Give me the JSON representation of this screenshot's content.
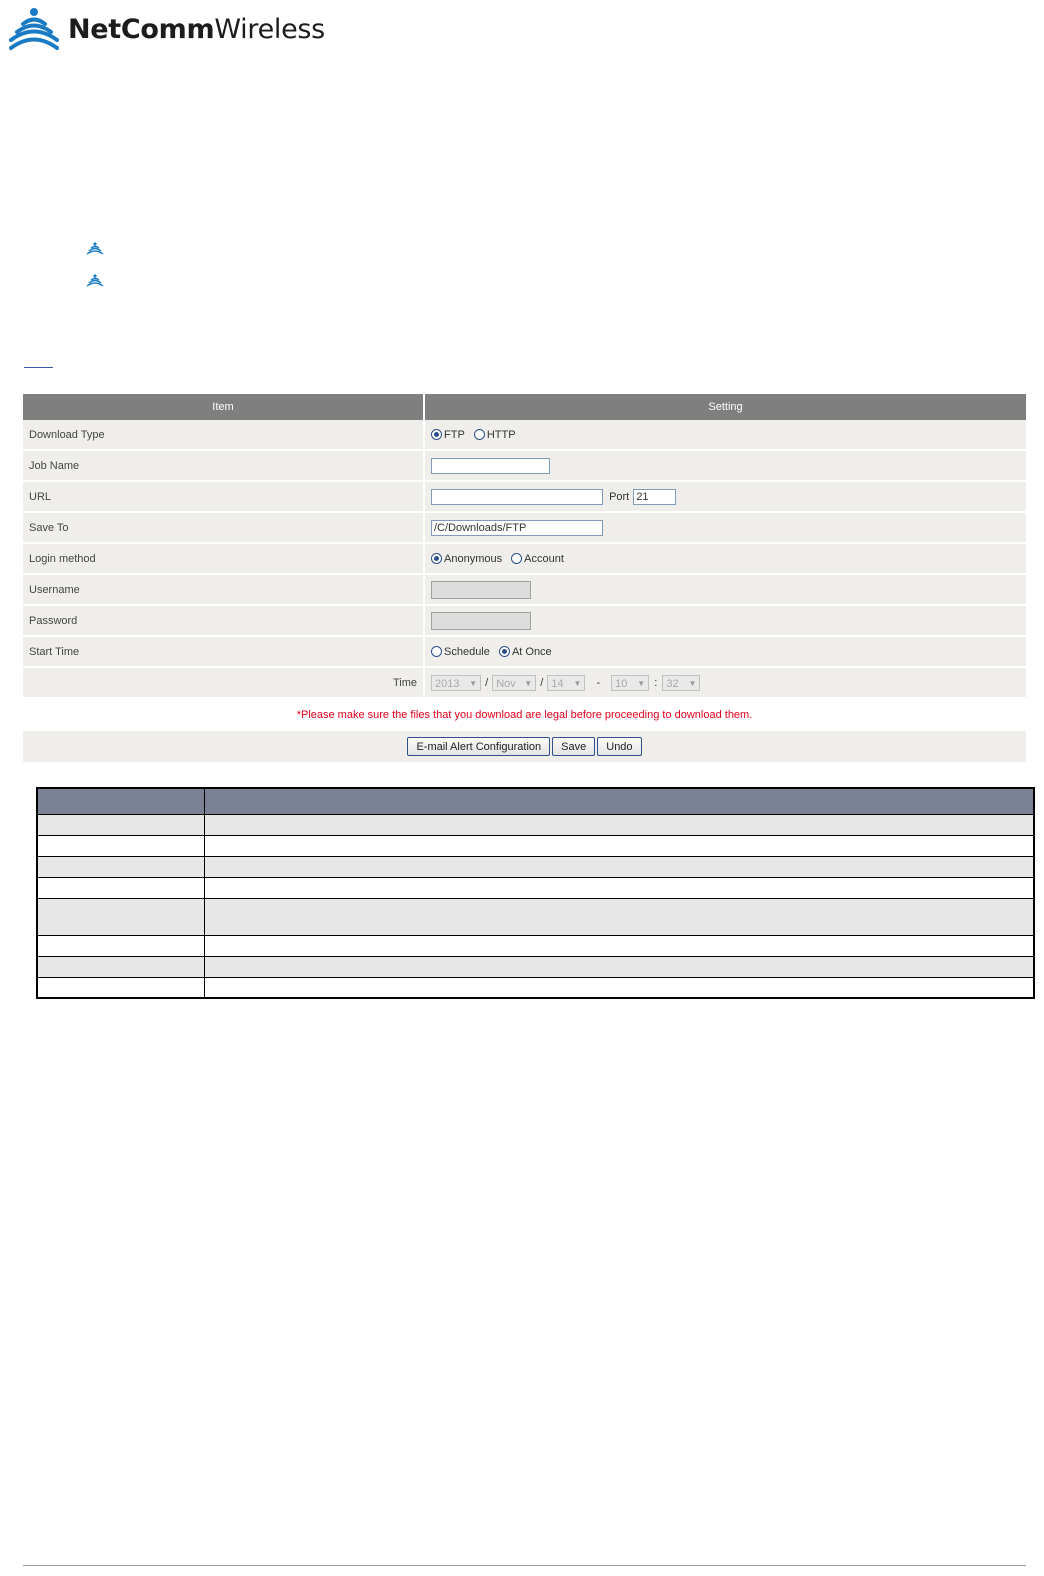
{
  "brand": {
    "bold": "NetComm",
    "light": "Wireless"
  },
  "bullet_icon": "netcomm-wifi-bullet-icon",
  "config_table": {
    "headers": {
      "item": "Item",
      "setting": "Setting"
    },
    "download_type": {
      "label": "Download Type",
      "opt1": "FTP",
      "opt2": "HTTP",
      "selected": "FTP"
    },
    "job_name": {
      "label": "Job Name",
      "value": ""
    },
    "url": {
      "label": "URL",
      "value": "",
      "port_label": "Port",
      "port_value": "21"
    },
    "save_to": {
      "label": "Save To",
      "value": "/C/Downloads/FTP"
    },
    "login_method": {
      "label": "Login method",
      "opt1": "Anonymous",
      "opt2": "Account",
      "selected": "Anonymous"
    },
    "username": {
      "label": "Username",
      "value": ""
    },
    "password": {
      "label": "Password",
      "value": ""
    },
    "start_time": {
      "label": "Start Time",
      "opt1": "Schedule",
      "opt2": "At Once",
      "selected": "At Once"
    },
    "time": {
      "label": "Time",
      "year": "2013",
      "month": "Nov",
      "day": "14",
      "hour": "10",
      "minute": "32",
      "sep_slash": "/",
      "sep_dash": "-",
      "sep_colon": ":"
    },
    "notice": "*Please make sure the files that you download are legal before proceeding to download them.",
    "buttons": {
      "email": "E-mail Alert Configuration",
      "save": "Save",
      "undo": "Undo"
    }
  },
  "colors": {
    "header_bg": "#7f7f7f",
    "row_bg": "#efeeea",
    "notice": "#e3001b",
    "brand_blue": "#1a7bc4"
  }
}
